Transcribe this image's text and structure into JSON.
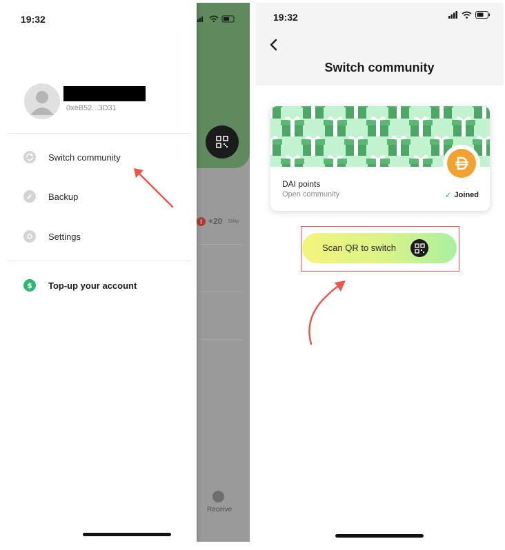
{
  "left_screen": {
    "status_time": "19:32",
    "account": {
      "address": "0xeB52...3D31"
    },
    "menu": [
      {
        "label": "Switch community",
        "icon": "switch-arrows-icon"
      },
      {
        "label": "Backup",
        "icon": "pencil-icon"
      },
      {
        "label": "Settings",
        "icon": "gear-icon"
      },
      {
        "label": "Top-up your account",
        "icon": "dollar-icon"
      }
    ],
    "background": {
      "transaction_amount": "+20",
      "transaction_unit": "DAIp",
      "receive_label": "Receive"
    }
  },
  "right_screen": {
    "status_time": "19:32",
    "title": "Switch community",
    "community": {
      "name": "DAI points",
      "subtitle": "Open community",
      "status": "Joined",
      "token_symbol": "DAI"
    },
    "scan_button_label": "Scan QR to switch"
  },
  "colors": {
    "accent_green": "#2eb872",
    "annotation_red": "#e8574a",
    "banner_green": "#c3f2d0",
    "gift_green": "#4da665",
    "dai_orange": "#f2a32f"
  }
}
